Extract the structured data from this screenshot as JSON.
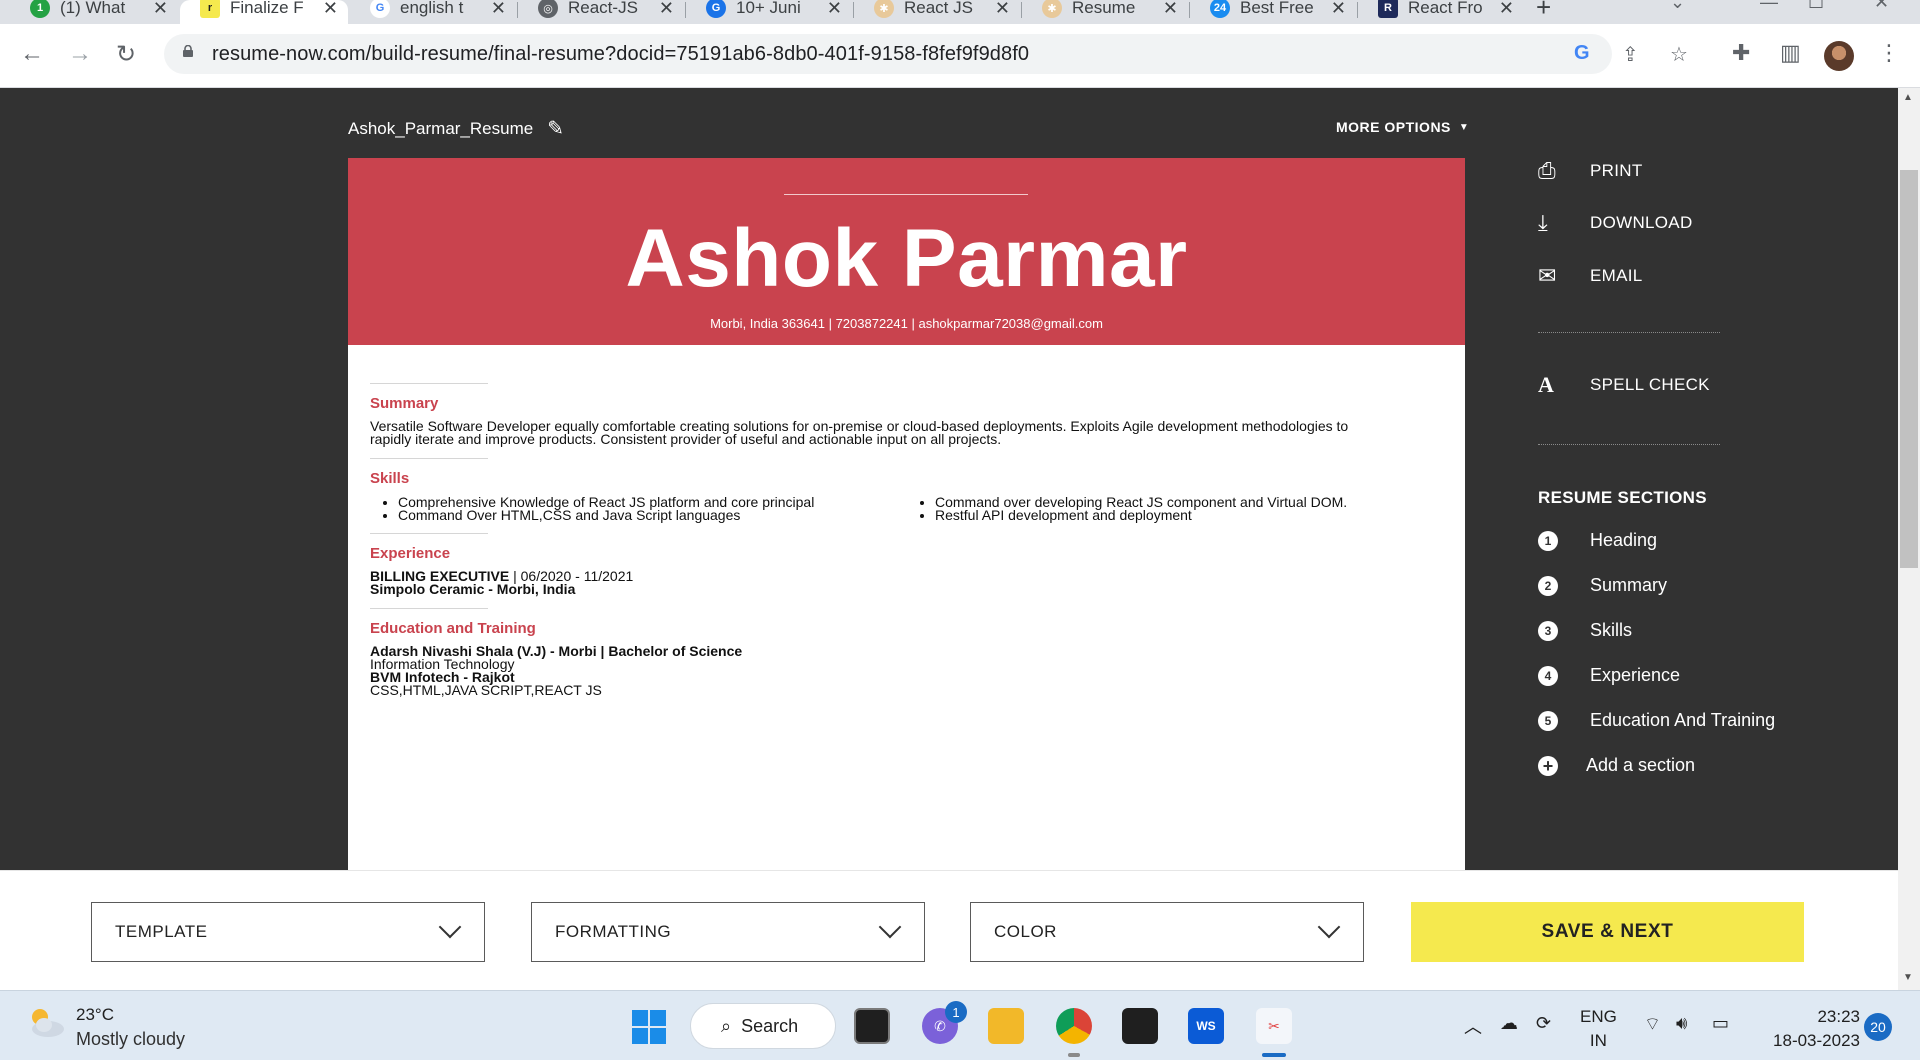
{
  "browser": {
    "tabs": [
      {
        "label": "(1) What",
        "icon_color": "#25a244",
        "icon_text": "1"
      },
      {
        "label": "Finalize F",
        "icon_color": "#1f1f1f",
        "icon_text": "r"
      },
      {
        "label": "english t",
        "icon_color": "#4285f4",
        "icon_text": "G"
      },
      {
        "label": "React-JS",
        "icon_color": "#5f6368",
        "icon_text": "◎"
      },
      {
        "label": "10+ Juni",
        "icon_color": "#1a73e8",
        "icon_text": "G"
      },
      {
        "label": "React JS",
        "icon_color": "#e8c99a",
        "icon_text": "✱"
      },
      {
        "label": "Resume",
        "icon_color": "#e8c99a",
        "icon_text": "✱"
      },
      {
        "label": "Best Free",
        "icon_color": "#1a8cf0",
        "icon_text": "24"
      },
      {
        "label": "React Fro",
        "icon_color": "#1e2a5a",
        "icon_text": "R"
      }
    ],
    "url": "resume-now.com/build-resume/final-resume?docid=75191ab6-8db0-401f-9158-f8fef9f9d8f0"
  },
  "editor": {
    "doc_name": "Ashok_Parmar_Resume",
    "more_options": "MORE OPTIONS"
  },
  "resume": {
    "name": "Ashok Parmar",
    "contact": "Morbi, India 363641  |  7203872241  |  ashokparmar72038@gmail.com",
    "summary_title": "Summary",
    "summary_text_1": "Versatile Software Developer equally comfortable creating solutions for on-premise or cloud-based deployments. Exploits Agile development methodologies to",
    "summary_text_2": "rapidly iterate and improve products. Consistent provider of useful and actionable input on all projects.",
    "skills_title": "Skills",
    "skills_left": [
      "Comprehensive Knowledge of React JS platform and core principal",
      "Command Over HTML,CSS and Java Script languages"
    ],
    "skills_right": [
      "Command over developing React JS component and Virtual DOM.",
      "Restful API development and deployment"
    ],
    "experience_title": "Experience",
    "exp_role": "BILLING EXECUTIVE",
    "exp_dates": " | 06/2020 - 11/2021",
    "exp_company": "Simpolo Ceramic - Morbi, India",
    "education_title": "Education and Training",
    "edu_1": "Adarsh Nivashi Shala (V.J) - Morbi | Bachelor of Science",
    "edu_1_sub": "Information Technology",
    "edu_2": "BVM Infotech - Rajkot",
    "edu_2_sub": "CSS,HTML,JAVA SCRIPT,REACT JS",
    "accent_color": "#c9434e"
  },
  "right_panel": {
    "print": "PRINT",
    "download": "DOWNLOAD",
    "email": "EMAIL",
    "spell_check": "SPELL CHECK",
    "spell_icon": "A",
    "sections_title": "RESUME SECTIONS",
    "sections": [
      {
        "num": "1",
        "label": "Heading"
      },
      {
        "num": "2",
        "label": "Summary"
      },
      {
        "num": "3",
        "label": "Skills"
      },
      {
        "num": "4",
        "label": "Experience"
      },
      {
        "num": "5",
        "label": "Education And Training"
      }
    ],
    "add_section": "Add a section"
  },
  "bottom_bar": {
    "template": "TEMPLATE",
    "formatting": "FORMATTING",
    "color": "COLOR",
    "save_next": "SAVE & NEXT",
    "save_color": "#f5e94e"
  },
  "taskbar": {
    "temperature": "23°C",
    "condition": "Mostly cloudy",
    "search": "Search",
    "teams_badge": "1",
    "lang_1": "ENG",
    "lang_2": "IN",
    "time": "23:23",
    "date": "18-03-2023",
    "notifications": "20"
  }
}
